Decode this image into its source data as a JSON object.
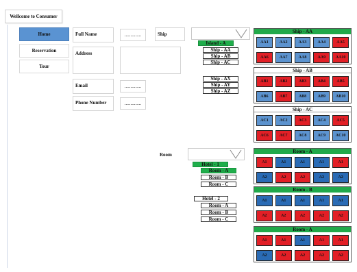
{
  "title": "Wellcome to Consumer",
  "nav": {
    "home": "Home",
    "reservation": "Reservation",
    "tour": "Tour"
  },
  "form": {
    "full_name_label": "Full Name",
    "full_name_value": "..............",
    "address_label": "Address",
    "email_label": "Email",
    "email_value": "..............",
    "phone_label": "Phone Number",
    "phone_value": ".............."
  },
  "ship": {
    "label": "Ship",
    "group1": [
      "Island - A",
      "Ship - AA",
      "Ship - AB",
      "Ship - AC"
    ],
    "group2": [
      "Ship - AX",
      "Ship - AY",
      "Ship - AZ"
    ]
  },
  "room": {
    "label": "Room",
    "hotel1": [
      "Hotel - 1",
      "Room - A",
      "Room - B",
      "Room - C"
    ],
    "hotel2": [
      "Hotel - 2",
      "Room - A",
      "Room - B",
      "Room - C"
    ]
  },
  "colors": {
    "red": "#e21f26",
    "blue": "#5c93cf",
    "dark_blue": "#2a6bb5",
    "green": "#21a94a",
    "nav_active": "#5a93d2"
  },
  "panels": [
    {
      "title": "Ship - AA",
      "header": "green",
      "cells": [
        {
          "t": "AA1",
          "c": "blue"
        },
        {
          "t": "AA2",
          "c": "blue"
        },
        {
          "t": "AA3",
          "c": "blue"
        },
        {
          "t": "AA4",
          "c": "blue"
        },
        {
          "t": "AA5",
          "c": "red"
        },
        {
          "t": "AA6",
          "c": "red"
        },
        {
          "t": "AA7",
          "c": "blue"
        },
        {
          "t": "AA8",
          "c": "blue"
        },
        {
          "t": "AA9",
          "c": "red"
        },
        {
          "t": "AA10",
          "c": "red"
        }
      ]
    },
    {
      "title": "Ship - AB",
      "header": "white",
      "cells": [
        {
          "t": "AB1",
          "c": "red"
        },
        {
          "t": "AB2",
          "c": "red"
        },
        {
          "t": "AB3",
          "c": "red"
        },
        {
          "t": "AB4",
          "c": "red"
        },
        {
          "t": "AB5",
          "c": "red"
        },
        {
          "t": "AB6",
          "c": "blue"
        },
        {
          "t": "AB7",
          "c": "red"
        },
        {
          "t": "AB8",
          "c": "blue"
        },
        {
          "t": "AB9",
          "c": "blue"
        },
        {
          "t": "AB10",
          "c": "blue"
        }
      ]
    },
    {
      "title": "Ship - AC",
      "header": "white",
      "cells": [
        {
          "t": "AC1",
          "c": "blue"
        },
        {
          "t": "AC2",
          "c": "blue"
        },
        {
          "t": "AC3",
          "c": "red"
        },
        {
          "t": "AC4",
          "c": "blue"
        },
        {
          "t": "AC5",
          "c": "red"
        },
        {
          "t": "AC6",
          "c": "red"
        },
        {
          "t": "AC7",
          "c": "red"
        },
        {
          "t": "AC8",
          "c": "blue"
        },
        {
          "t": "AC9",
          "c": "blue"
        },
        {
          "t": "AC10",
          "c": "blue"
        }
      ]
    },
    {
      "title": "Room - A",
      "header": "green",
      "cells": [
        {
          "t": "A1",
          "c": "red"
        },
        {
          "t": "A1",
          "c": "dblue"
        },
        {
          "t": "A1",
          "c": "dblue"
        },
        {
          "t": "A1",
          "c": "dblue"
        },
        {
          "t": "A1",
          "c": "red"
        },
        {
          "t": "A2",
          "c": "dblue"
        },
        {
          "t": "A2",
          "c": "red"
        },
        {
          "t": "A2",
          "c": "red"
        },
        {
          "t": "A2",
          "c": "dblue"
        },
        {
          "t": "A2",
          "c": "dblue"
        }
      ]
    },
    {
      "title": "Room - B",
      "header": "green",
      "cells": [
        {
          "t": "A1",
          "c": "dblue"
        },
        {
          "t": "A1",
          "c": "dblue"
        },
        {
          "t": "A1",
          "c": "dblue"
        },
        {
          "t": "A1",
          "c": "dblue"
        },
        {
          "t": "A1",
          "c": "dblue"
        },
        {
          "t": "A2",
          "c": "red"
        },
        {
          "t": "A2",
          "c": "red"
        },
        {
          "t": "A2",
          "c": "red"
        },
        {
          "t": "A2",
          "c": "red"
        },
        {
          "t": "A2",
          "c": "red"
        }
      ]
    },
    {
      "title": "Room - A",
      "header": "green",
      "cells": [
        {
          "t": "A1",
          "c": "red"
        },
        {
          "t": "A1",
          "c": "red"
        },
        {
          "t": "A1",
          "c": "dblue"
        },
        {
          "t": "A1",
          "c": "red"
        },
        {
          "t": "A1",
          "c": "red"
        },
        {
          "t": "A2",
          "c": "dblue"
        },
        {
          "t": "A2",
          "c": "red"
        },
        {
          "t": "A2",
          "c": "red"
        },
        {
          "t": "A2",
          "c": "red"
        },
        {
          "t": "A2",
          "c": "red"
        }
      ]
    }
  ]
}
